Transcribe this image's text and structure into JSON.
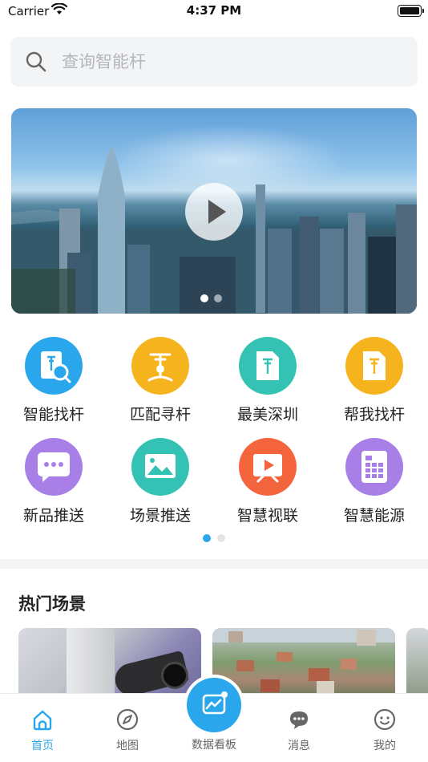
{
  "status_bar": {
    "carrier": "Carrier",
    "time": "4:37 PM"
  },
  "search": {
    "placeholder": "查询智能杆"
  },
  "banner": {
    "page_index": 1,
    "page_count": 2
  },
  "functions": [
    {
      "label": "智能找杆",
      "icon": "smart-pole-search-icon",
      "color": "#2aa7ec"
    },
    {
      "label": "匹配寻杆",
      "icon": "match-pole-icon",
      "color": "#f5b31e"
    },
    {
      "label": "最美深圳",
      "icon": "beautiful-shenzhen-icon",
      "color": "#34c2b4"
    },
    {
      "label": "帮我找杆",
      "icon": "help-find-pole-icon",
      "color": "#f5b31e"
    },
    {
      "label": "新品推送",
      "icon": "new-product-chat-icon",
      "color": "#a77fe6"
    },
    {
      "label": "场景推送",
      "icon": "scene-image-icon",
      "color": "#34c2b4"
    },
    {
      "label": "智慧视联",
      "icon": "smart-video-play-icon",
      "color": "#f4643d"
    },
    {
      "label": "智慧能源",
      "icon": "smart-energy-battery-icon",
      "color": "#a77fe6"
    }
  ],
  "function_pager": {
    "page_index": 1,
    "page_count": 2
  },
  "hot_scenes": {
    "title": "热门场景"
  },
  "tab_bar": {
    "tabs": [
      {
        "label": "首页",
        "icon": "home-icon",
        "active": true
      },
      {
        "label": "地图",
        "icon": "compass-icon",
        "active": false
      },
      {
        "label": "数据看板",
        "icon": "data-dashboard-icon",
        "active": false
      },
      {
        "label": "消息",
        "icon": "message-icon",
        "active": false
      },
      {
        "label": "我的",
        "icon": "profile-icon",
        "active": false
      }
    ]
  },
  "colors": {
    "accent": "#2aa7ec",
    "tab_inactive": "#666666",
    "search_bg": "#f3f4f6"
  }
}
